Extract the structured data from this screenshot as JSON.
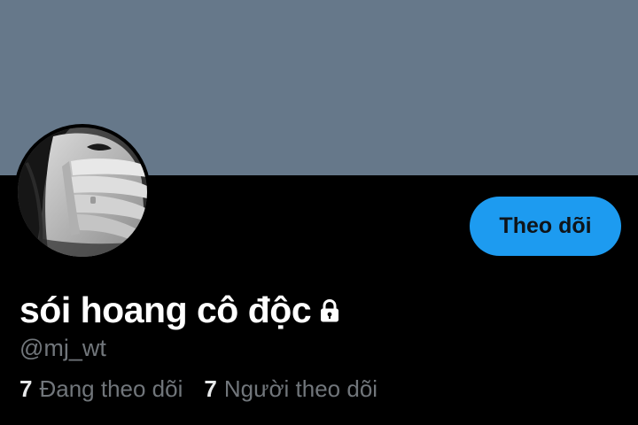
{
  "profile": {
    "display_name": "sói hoang cô độc",
    "handle": "@mj_wt",
    "follow_button_label": "Theo dõi",
    "lock_icon": "lock-icon",
    "following_count": "7",
    "following_label": "Đang theo dõi",
    "followers_count": "7",
    "followers_label": "Người theo dõi"
  },
  "colors": {
    "banner": "#66788a",
    "background": "#000000",
    "follow_button": "#1d9bf0",
    "muted_text": "#71767b",
    "primary_text": "#ffffff"
  }
}
